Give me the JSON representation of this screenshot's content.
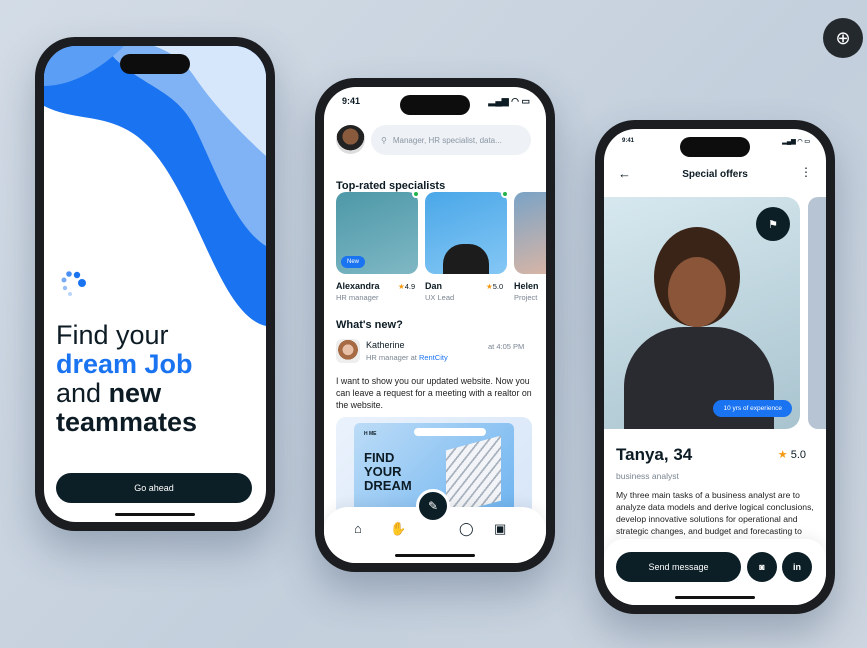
{
  "zoom_button": {
    "icon": "zoom-in-icon"
  },
  "onboarding": {
    "line1": "Find your",
    "line2": "dream Job",
    "line3a": "and ",
    "line3b": "new",
    "line4": "teammates",
    "button": "Go ahead"
  },
  "feed": {
    "time": "9:41",
    "search_placeholder": "Manager, HR specialist, data...",
    "top_rated": "Top-rated specialists",
    "specialists": [
      {
        "name": "Alexandra",
        "role": "HR manager",
        "rating": "4.9",
        "badge": "New"
      },
      {
        "name": "Dan",
        "role": "UX Lead",
        "rating": "5.0"
      },
      {
        "name": "Helen",
        "role": "Project"
      }
    ],
    "whats_new": "What's new?",
    "post": {
      "author": "Katherine",
      "role": "HR manager at ",
      "company": "RentCity",
      "time": "at 4:05 PM",
      "text": "I want to show you our updated website. Now you can leave a request for a meeting with a realtor on the website.",
      "preview_logo": "H ME",
      "preview_title": "FIND YOUR DREAM"
    }
  },
  "profile": {
    "time": "9:41",
    "title": "Special offers",
    "experience": "10 yrs of experience",
    "name": "Tanya, 34",
    "rating": "5.0",
    "role": "business analyst",
    "bio": "My three main tasks of a business analyst are to analyze data models and derive logical conclusions, develop innovative solutions for operational and strategic changes, and budget and forecasting to",
    "send": "Send message"
  },
  "colors": {
    "accent": "#1a73f0",
    "dark": "#0c1f27"
  }
}
